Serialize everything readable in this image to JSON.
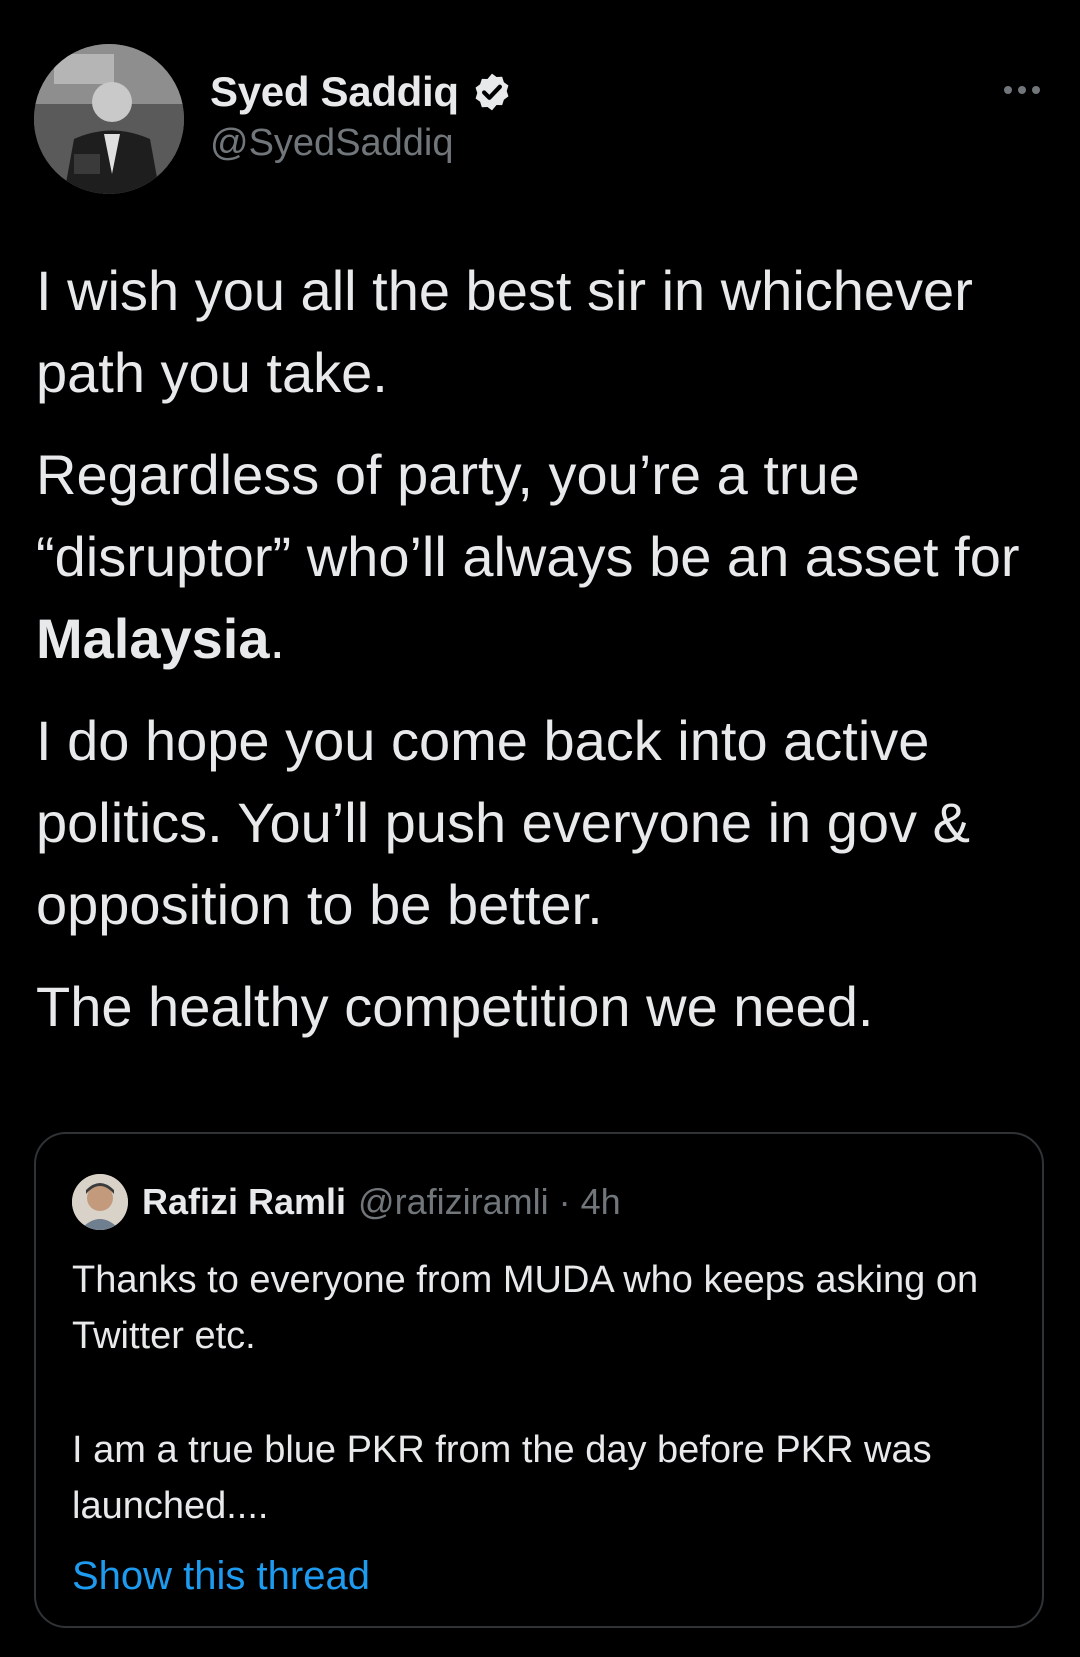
{
  "tweet": {
    "author": {
      "display_name": "Syed Saddiq",
      "handle": "@SyedSaddiq",
      "verified": true,
      "avatar_icon": "profile-photo"
    },
    "more_icon": "more-dots-icon",
    "paragraphs": [
      "I wish you all the best sir in whichever path you take.",
      "Regardless of party, you’re a true “disruptor” who’ll always be an asset for ",
      "I do hope you come back into active politics. You’ll push everyone in gov & opposition to be better.",
      "The healthy competition we need."
    ],
    "bold_word": "Malaysia",
    "bold_suffix": "."
  },
  "quoted_tweet": {
    "author": {
      "display_name": "Rafizi Ramli",
      "handle_time": "@rafiziramli · 4h",
      "avatar_icon": "profile-photo"
    },
    "paragraphs": [
      "Thanks to everyone from MUDA who keeps asking on Twitter etc.",
      "I am a true blue PKR from the day before PKR was launched...."
    ],
    "show_thread_label": "Show this thread"
  },
  "colors": {
    "background": "#000000",
    "text": "#e7e9ea",
    "secondary_text": "#71767b",
    "link": "#1d9bf0",
    "border": "#2f3336"
  }
}
